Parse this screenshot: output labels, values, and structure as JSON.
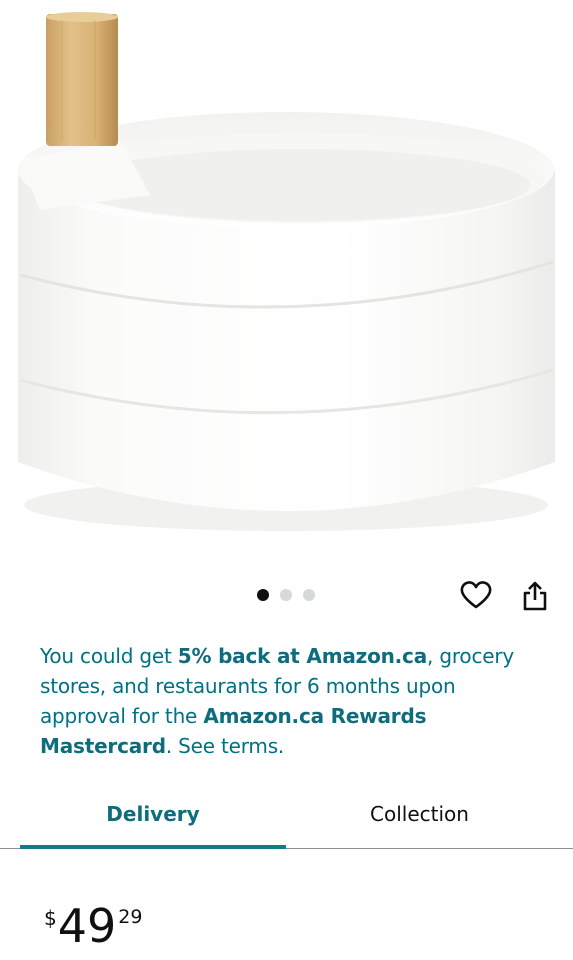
{
  "carousel": {
    "dot_count": 3,
    "active_index": 0
  },
  "promo": {
    "text_1": "You could get ",
    "bold_1": "5% back at Amazon.ca",
    "text_2": ", grocery stores, and restaurants for 6 months upon approval for the ",
    "bold_2": "Amazon.ca Rewards Mastercard",
    "text_3": ". See terms."
  },
  "tabs": [
    {
      "label": "Delivery",
      "selected": true
    },
    {
      "label": "Collection",
      "selected": false
    }
  ],
  "price": {
    "symbol": "$",
    "whole": "49",
    "fraction": "29"
  },
  "colors": {
    "link_teal": "#007185",
    "tab_underline": "#137a86",
    "text_dark": "#0f1111",
    "dot_inactive": "#d5d9d9"
  },
  "icons": {
    "favorite": "heart-icon",
    "share": "share-icon"
  }
}
